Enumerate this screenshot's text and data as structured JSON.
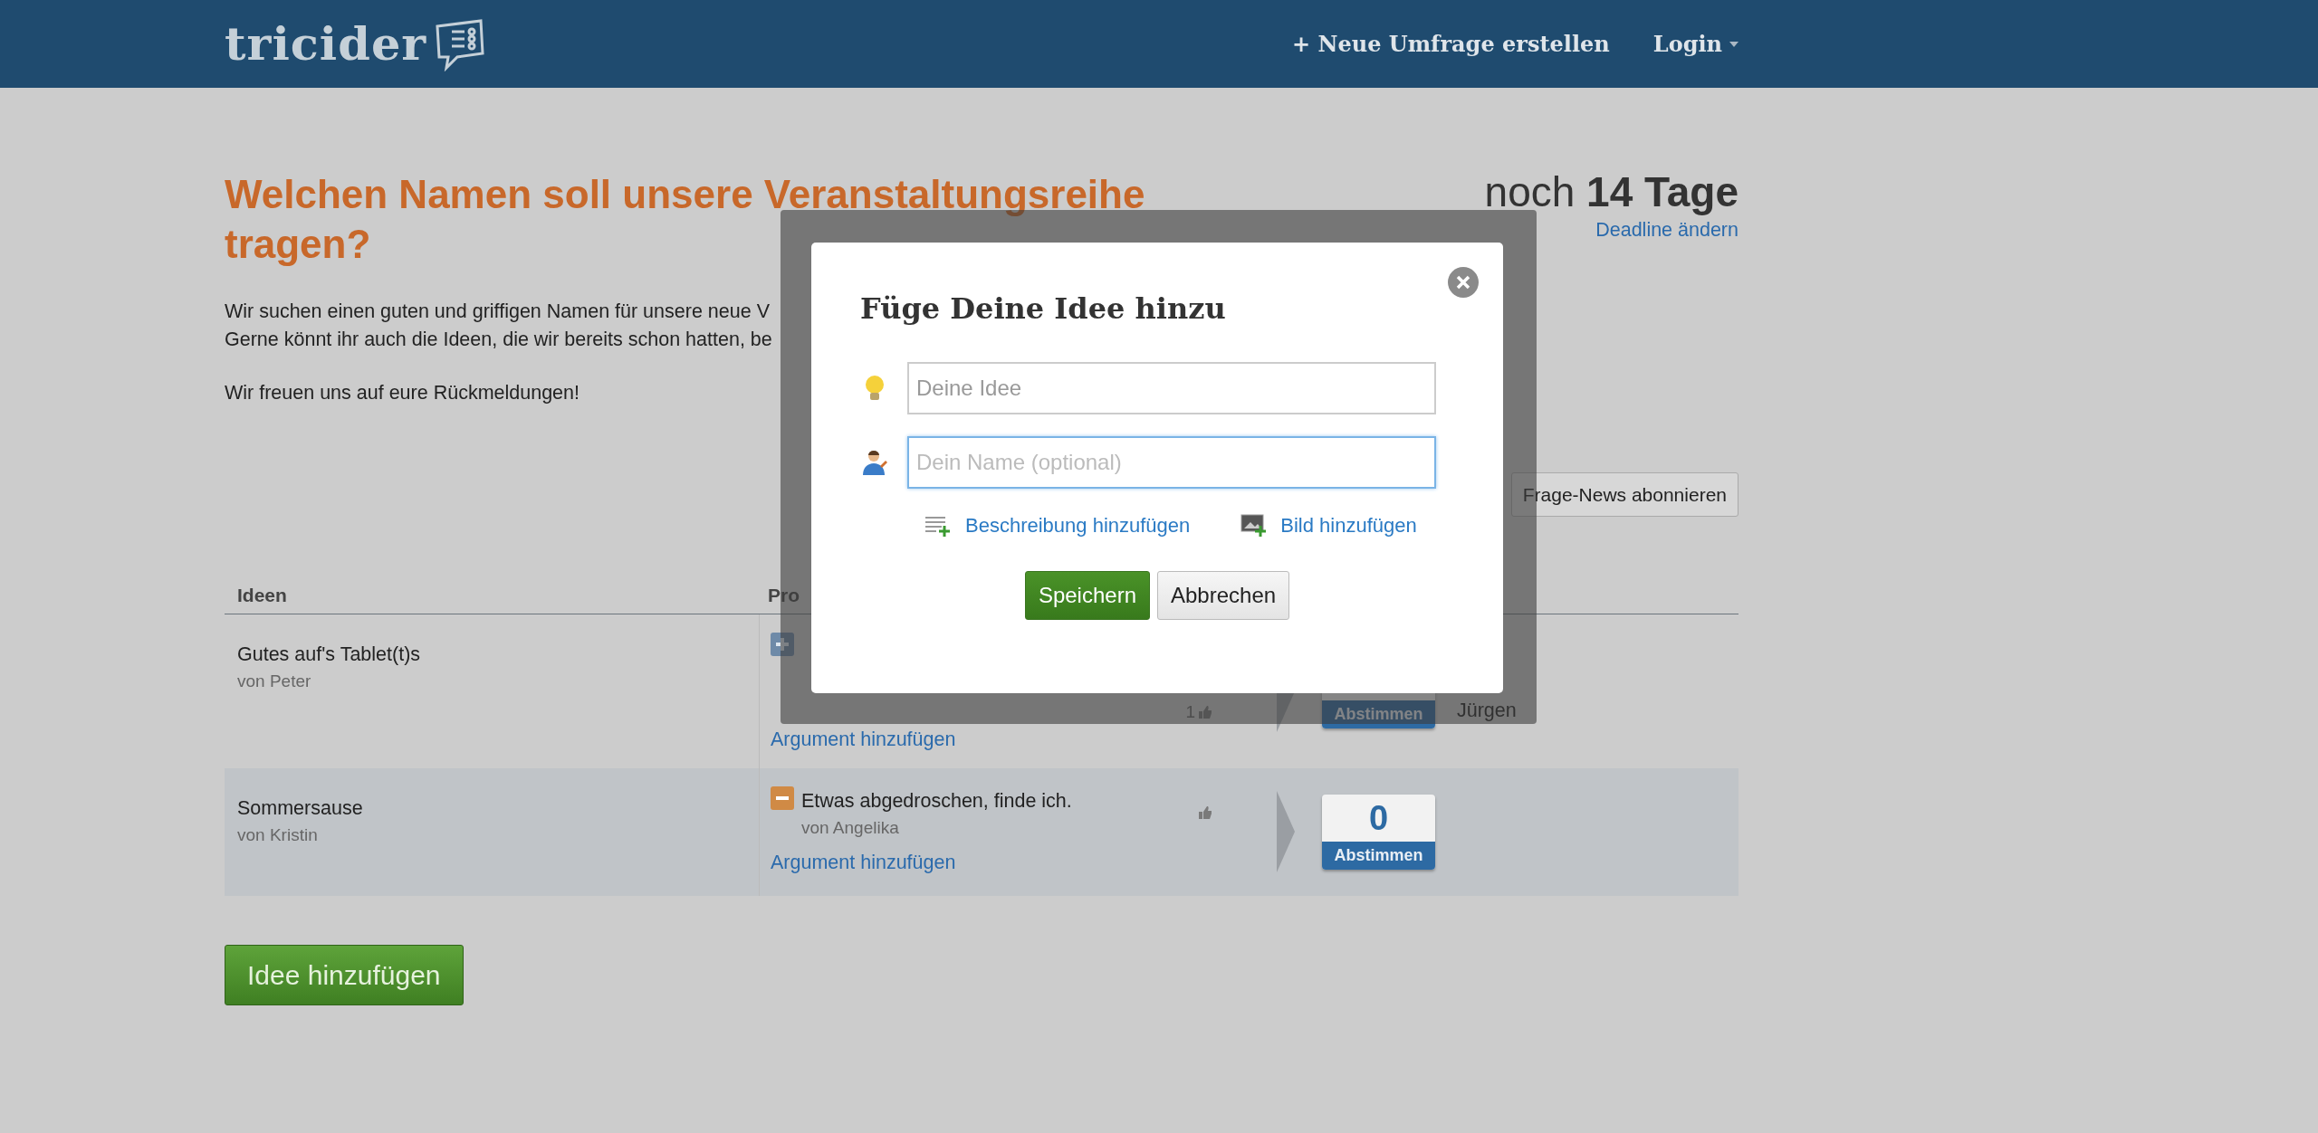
{
  "header": {
    "logo": "tricider",
    "nav": [
      {
        "kind": "link",
        "label": "+ Neue Umfrage erstellen"
      },
      {
        "kind": "dropdown",
        "label": "Login"
      }
    ]
  },
  "question": {
    "title": "Welchen Namen soll unsere Veranstaltungsreihe tragen?",
    "description": [
      "Wir suchen einen guten und griffigen Namen für unsere neue V",
      "Gerne könnt ihr auch die Ideen, die wir bereits schon hatten, be"
    ],
    "closing": "Wir freuen uns auf eure Rückmeldungen!"
  },
  "deadline": {
    "prefix": "noch",
    "value": "14 Tage",
    "link": "Deadline ändern"
  },
  "subscribe_button": "Frage-News abonnieren",
  "table": {
    "columns": [
      "Ideen",
      "Pro"
    ],
    "rows": [
      {
        "idea": "Gutes auf's Tablet(t)s",
        "author": "von Peter",
        "highlighted": false,
        "arguments": [
          {
            "kind": "pro",
            "likes": "1"
          }
        ],
        "add_argument": "Argument hinzufügen",
        "vote_label": "Abstimmen",
        "contra_author": "Jürgen"
      },
      {
        "idea": "Sommersause",
        "author": "von Kristin",
        "highlighted": true,
        "arguments": [
          {
            "kind": "contra",
            "text": "Etwas abgedroschen, finde ich.",
            "author": "von Angelika"
          }
        ],
        "add_argument": "Argument hinzufügen",
        "votes": "0",
        "vote_label": "Abstimmen"
      }
    ]
  },
  "add_idea_button": "Idee hinzufügen",
  "modal": {
    "title": "Füge Deine Idee hinzu",
    "fields": [
      {
        "kind": "idea",
        "placeholder": "Deine Idee",
        "focused": false
      },
      {
        "kind": "name",
        "placeholder": "Dein Name (optional)",
        "focused": true
      }
    ],
    "links": [
      {
        "kind": "description",
        "label": "Beschreibung hinzufügen"
      },
      {
        "kind": "image",
        "label": "Bild hinzufügen"
      }
    ],
    "buttons": [
      {
        "kind": "primary",
        "label": "Speichern"
      },
      {
        "kind": "secondary",
        "label": "Abbrechen"
      }
    ]
  }
}
